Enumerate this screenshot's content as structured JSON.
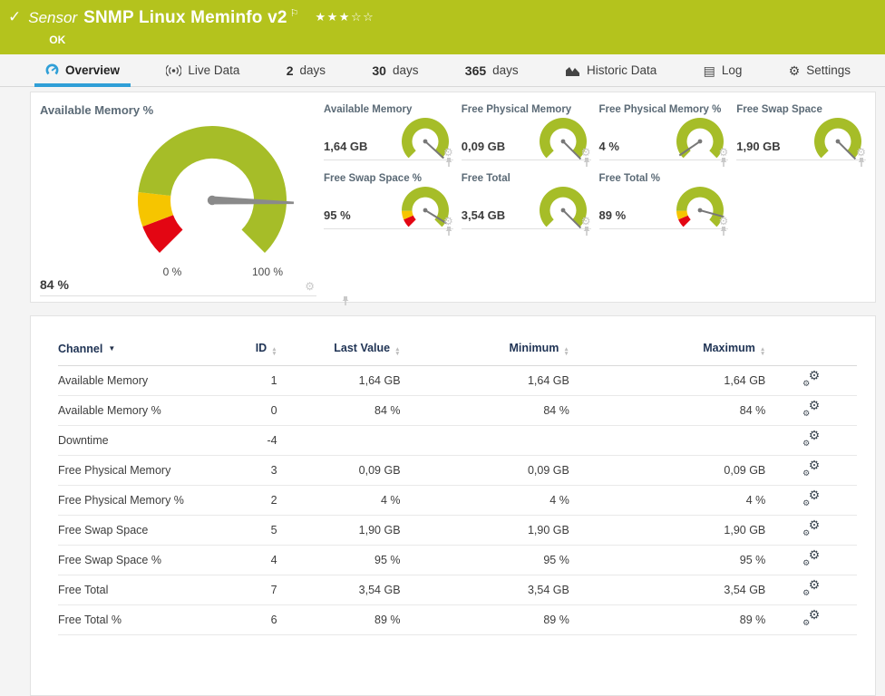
{
  "colors": {
    "status_green": "#b4c31d",
    "accent_blue": "#2f9fd7",
    "gauge_green": "#a6bd28",
    "gauge_yellow": "#f6c500",
    "gauge_red": "#e30613",
    "needle_gray": "#8a8a8a",
    "icon_gray": "#c9c9c9"
  },
  "header": {
    "kind_label": "Sensor",
    "title": "SNMP Linux Meminfo v2",
    "status": "OK",
    "rating": {
      "filled": 3,
      "total": 5
    }
  },
  "tabs": [
    {
      "label": "Overview",
      "icon": "gauge-icon",
      "active": true
    },
    {
      "label": "Live Data",
      "icon": "broadcast-icon",
      "active": false
    },
    {
      "number": "2",
      "label": "days",
      "active": false
    },
    {
      "number": "30",
      "label": "days",
      "active": false
    },
    {
      "number": "365",
      "label": "days",
      "active": false
    },
    {
      "label": "Historic Data",
      "icon": "chart-icon",
      "active": false
    },
    {
      "label": "Log",
      "icon": "log-icon",
      "active": false
    },
    {
      "label": "Settings",
      "icon": "gear-icon",
      "active": false
    }
  ],
  "overview": {
    "main_gauge": {
      "title": "Available Memory %",
      "value": "84 %",
      "scale_min": "0 %",
      "scale_max": "100 %",
      "percent": 84,
      "segments": [
        {
          "to": 9,
          "color": "red"
        },
        {
          "to": 19,
          "color": "yellow"
        },
        {
          "to": 100,
          "color": "green"
        }
      ]
    },
    "small_gauges": [
      {
        "title": "Available Memory",
        "value": "1,64 GB",
        "percent": 99,
        "segments": [
          {
            "to": 100,
            "color": "green"
          }
        ]
      },
      {
        "title": "Free Physical Memory",
        "value": "0,09 GB",
        "percent": 100,
        "segments": [
          {
            "to": 100,
            "color": "green"
          }
        ]
      },
      {
        "title": "Free Physical Memory %",
        "value": "4 %",
        "percent": 4,
        "segments": [
          {
            "to": 100,
            "color": "green"
          }
        ]
      },
      {
        "title": "Free Swap Space",
        "value": "1,90 GB",
        "percent": 100,
        "segments": [
          {
            "to": 100,
            "color": "green"
          }
        ]
      },
      {
        "title": "Free Swap Space %",
        "value": "95 %",
        "percent": 95,
        "segments": [
          {
            "to": 8,
            "color": "red"
          },
          {
            "to": 16,
            "color": "yellow"
          },
          {
            "to": 100,
            "color": "green"
          }
        ]
      },
      {
        "title": "Free Total",
        "value": "3,54 GB",
        "percent": 100,
        "segments": [
          {
            "to": 100,
            "color": "green"
          }
        ]
      },
      {
        "title": "Free Total %",
        "value": "89 %",
        "percent": 89,
        "segments": [
          {
            "to": 8,
            "color": "red"
          },
          {
            "to": 16,
            "color": "yellow"
          },
          {
            "to": 100,
            "color": "green"
          }
        ]
      }
    ]
  },
  "table": {
    "columns": [
      {
        "label": "Channel",
        "sort": "caret"
      },
      {
        "label": "ID",
        "sort": "arrows"
      },
      {
        "label": "Last Value",
        "sort": "arrows"
      },
      {
        "label": "Minimum",
        "sort": "arrows"
      },
      {
        "label": "Maximum",
        "sort": "arrows"
      }
    ],
    "rows": [
      {
        "channel": "Available Memory",
        "id": "1",
        "last": "1,64 GB",
        "min": "1,64 GB",
        "max": "1,64 GB"
      },
      {
        "channel": "Available Memory %",
        "id": "0",
        "last": "84 %",
        "min": "84 %",
        "max": "84 %"
      },
      {
        "channel": "Downtime",
        "id": "-4",
        "last": "",
        "min": "",
        "max": ""
      },
      {
        "channel": "Free Physical Memory",
        "id": "3",
        "last": "0,09 GB",
        "min": "0,09 GB",
        "max": "0,09 GB"
      },
      {
        "channel": "Free Physical Memory %",
        "id": "2",
        "last": "4 %",
        "min": "4 %",
        "max": "4 %"
      },
      {
        "channel": "Free Swap Space",
        "id": "5",
        "last": "1,90 GB",
        "min": "1,90 GB",
        "max": "1,90 GB"
      },
      {
        "channel": "Free Swap Space %",
        "id": "4",
        "last": "95 %",
        "min": "95 %",
        "max": "95 %"
      },
      {
        "channel": "Free Total",
        "id": "7",
        "last": "3,54 GB",
        "min": "3,54 GB",
        "max": "3,54 GB"
      },
      {
        "channel": "Free Total %",
        "id": "6",
        "last": "89 %",
        "min": "89 %",
        "max": "89 %"
      }
    ]
  }
}
